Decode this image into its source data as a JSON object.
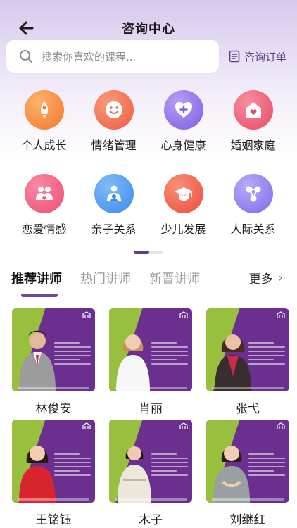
{
  "header": {
    "title": "咨询中心"
  },
  "search": {
    "placeholder": "搜索你喜欢的课程..."
  },
  "order_link": {
    "label": "咨询订单"
  },
  "categories": [
    {
      "label": "个人成长",
      "icon": "rocket-icon",
      "color": "#f6893b"
    },
    {
      "label": "情绪管理",
      "icon": "smile-icon",
      "color": "#f0654d"
    },
    {
      "label": "心身健康",
      "icon": "heart-plus-icon",
      "color": "#8f6de8"
    },
    {
      "label": "婚姻家庭",
      "icon": "heart-home-icon",
      "color": "#ee5873"
    },
    {
      "label": "恋爱情感",
      "icon": "couple-icon",
      "color": "#f15a7c"
    },
    {
      "label": "亲子关系",
      "icon": "parent-child-icon",
      "color": "#4b9af0"
    },
    {
      "label": "少儿发展",
      "icon": "graduation-cap-icon",
      "color": "#f0574b"
    },
    {
      "label": "人际关系",
      "icon": "network-icon",
      "color": "#8c7ef0"
    }
  ],
  "tabs": [
    {
      "label": "推荐讲师",
      "active": true
    },
    {
      "label": "热门讲师",
      "active": false
    },
    {
      "label": "新晋讲师",
      "active": false
    }
  ],
  "more": {
    "label": "更多"
  },
  "teachers": [
    {
      "name": "林俊安"
    },
    {
      "name": "肖丽"
    },
    {
      "name": "张弋"
    },
    {
      "name": "王铭钰"
    },
    {
      "name": "木子"
    },
    {
      "name": "刘继红"
    }
  ],
  "colors": {
    "accent": "#6a45a8",
    "card_bg": "#6a2f8f",
    "card_green": "#9bc83a"
  }
}
